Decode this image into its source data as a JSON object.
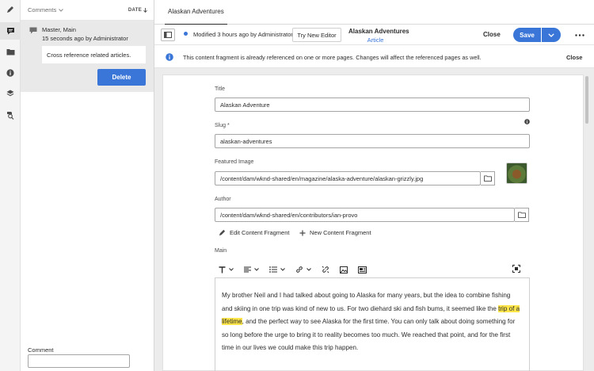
{
  "rail": {
    "icons": [
      "pencil-icon",
      "comment-icon",
      "folder-icon",
      "info-icon",
      "layers-icon",
      "references-search-icon"
    ],
    "active_index": 1
  },
  "comments_panel": {
    "header_label": "Comments",
    "sort_label": "DATE",
    "comment": {
      "variations": "Master, Main",
      "meta": "15 seconds ago by Administrator",
      "text": "Cross reference related articles."
    },
    "delete_label": "Delete",
    "comment_input_label": "Comment",
    "comment_input_value": ""
  },
  "tab": {
    "label": "Alaskan Adventures"
  },
  "toolbar": {
    "status": "Modified 3 hours ago by Administrator",
    "try_new_editor": "Try New Editor",
    "fragment_title": "Alaskan Adventures",
    "fragment_model": "Article",
    "close_label": "Close",
    "save_label": "Save",
    "accent_color": "#3a76d8"
  },
  "banner": {
    "message": "This content fragment is already referenced on one or more pages. Changes will affect the referenced pages as well.",
    "close_label": "Close"
  },
  "form": {
    "title_label": "Title",
    "title_value": "Alaskan Adventure",
    "slug_label": "Slug *",
    "slug_value": "alaskan-adventures",
    "featured_image_label": "Featured Image",
    "featured_image_value": "/content/dam/wknd-shared/en/magazine/alaska-adventure/alaskan-grizzly.jpg",
    "author_label": "Author",
    "author_value": "/content/dam/wknd-shared/en/contributors/ian-provo",
    "edit_content_fragment": "Edit Content Fragment",
    "new_content_fragment": "New Content Fragment",
    "main_label": "Main",
    "main_text_before": "My brother Neil and I had talked about going to Alaska for many years, but the idea to combine fishing and skiing in one trip was kind of new to us. For two diehard ski and fish bums, it seemed like the ",
    "main_text_highlight": "trip of a lifetime",
    "main_text_after": ", and the perfect way to see Alaska for the first time. You can only talk about doing something for so long before the urge to bring it to reality becomes too much. We reached that point, and for the first time in our lives we could make this trip happen.",
    "highlight_color": "#fde54a"
  }
}
